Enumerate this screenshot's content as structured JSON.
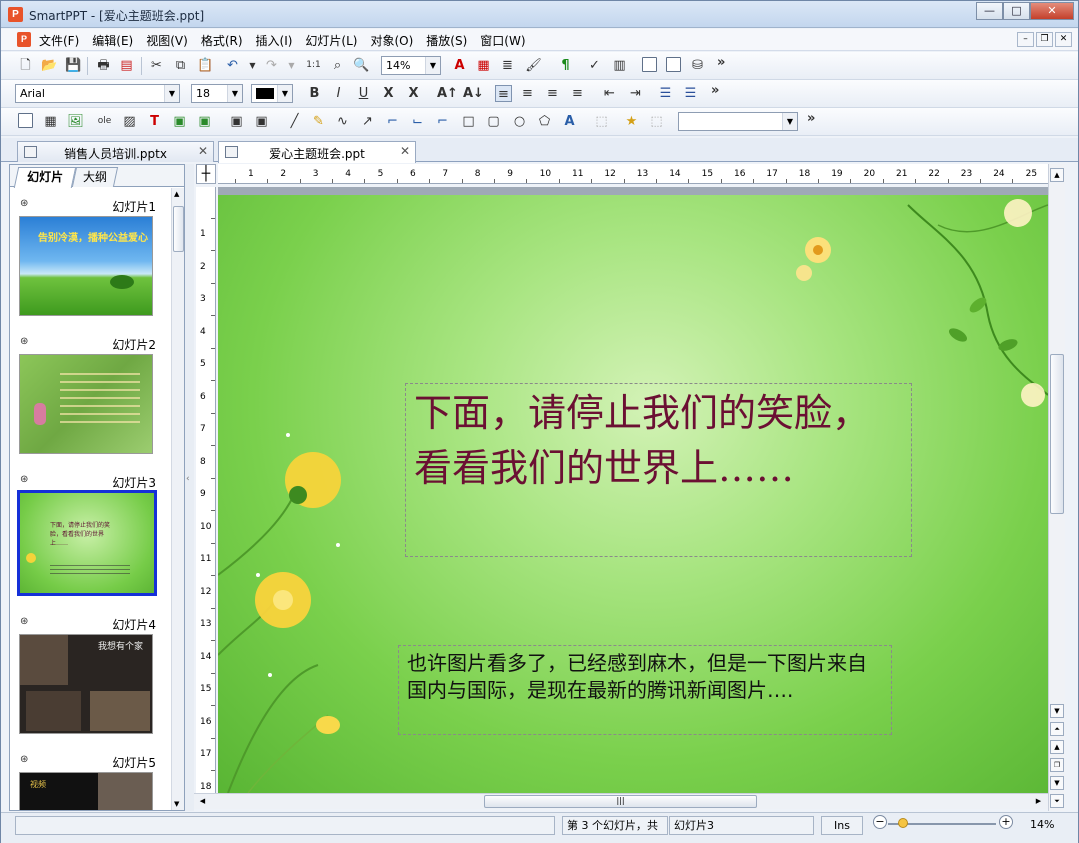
{
  "window": {
    "title": "SmartPPT - [爱心主题班会.ppt]",
    "app_icon": "P",
    "minimize": "—",
    "maximize": "□",
    "close": "✕"
  },
  "menu": {
    "items": [
      "文件(F)",
      "编辑(E)",
      "视图(V)",
      "格式(R)",
      "插入(I)",
      "幻灯片(L)",
      "对象(O)",
      "播放(S)",
      "窗口(W)"
    ],
    "mdi_min": "–",
    "mdi_restore": "❐",
    "mdi_close": "✕"
  },
  "toolbar": {
    "zoom": "14%",
    "font_name": "Arial",
    "font_size": "18",
    "more": "»",
    "bold": "B",
    "italic": "I",
    "underline": "U",
    "strike": "X",
    "clear": "X"
  },
  "doc_tabs": [
    {
      "label": "销售人员培训.pptx",
      "close": "✕"
    },
    {
      "label": "爱心主题班会.ppt",
      "close": "✕"
    }
  ],
  "left_pane": {
    "tabs": [
      "幻灯片",
      "大纲"
    ],
    "slides": [
      {
        "name": "幻灯片1",
        "caption": "告别冷漠，播种公益爱心"
      },
      {
        "name": "幻灯片2",
        "caption": ""
      },
      {
        "name": "幻灯片3",
        "caption": "下面，请停止我们的笑脸，看看我们的世界上……"
      },
      {
        "name": "幻灯片4",
        "caption": "我想有个家"
      },
      {
        "name": "幻灯片5",
        "caption": "视频"
      }
    ]
  },
  "slide": {
    "title": "下面，请停止我们的笑脸，看看我们的世界上……",
    "body": "也许图片看多了，已经感到麻木，但是一下图片来自国内与国际，是现在最新的腾讯新闻图片…."
  },
  "ruler": {
    "h_ticks": [
      "1",
      "2",
      "3",
      "4",
      "5",
      "6",
      "7",
      "8",
      "9",
      "10",
      "11",
      "12",
      "13",
      "14",
      "15",
      "16",
      "17",
      "18",
      "19",
      "20",
      "21",
      "22",
      "23",
      "24",
      "25"
    ],
    "v_ticks": [
      "1",
      "2",
      "3",
      "4",
      "5",
      "6",
      "7",
      "8",
      "9",
      "10",
      "11",
      "12",
      "13",
      "14",
      "15",
      "16",
      "17",
      "18"
    ],
    "corner": "┼"
  },
  "status": {
    "position": "第 3 个幻灯片，共",
    "slide_name": "幻灯片3",
    "mode": "Ins",
    "zoom": "14%",
    "zoom_minus": "−",
    "zoom_plus": "+"
  },
  "colors": {
    "title_text": "#6b1033",
    "selected_thumb_border": "#1530d8",
    "slide_bg": "#8fd85e"
  }
}
